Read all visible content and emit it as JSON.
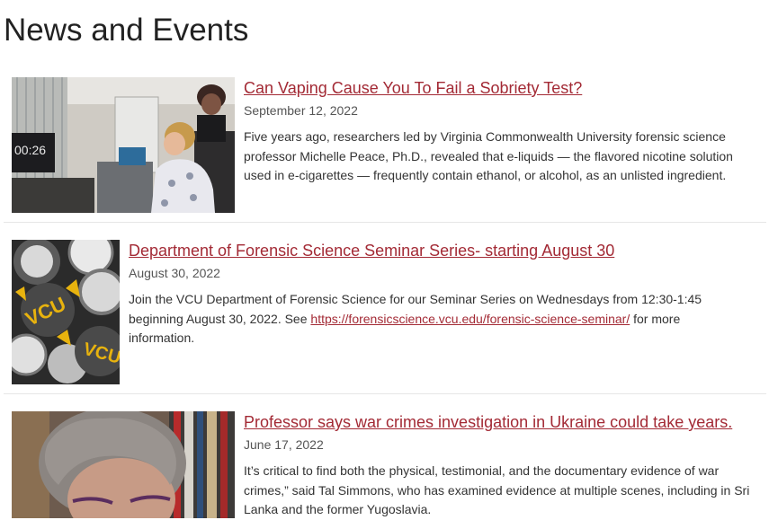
{
  "page": {
    "title": "News and Events"
  },
  "items": [
    {
      "headline": "Can Vaping Cause You To Fail a Sobriety Test?",
      "date": "September 12, 2022",
      "summary": "Five years ago, researchers led by Virginia Commonwealth University forensic science professor Michelle Peace, Ph.D., revealed that e-liquids — the flavored nicotine solution used in e-cigarettes — frequently contain ethanol, or alcohol, as an unlisted ingredient.",
      "thumb_caption": "00:26"
    },
    {
      "headline": "Department of Forensic Science Seminar Series- starting August 30",
      "date": "August 30, 2022",
      "summary_before": "Join the VCU Department of Forensic Science for our Seminar Series on Wednesdays from 12:30-1:45 beginning August 30, 2022. See ",
      "summary_link": "https://forensicscience.vcu.edu/forensic-science-seminar/",
      "summary_after": " for more information.",
      "thumb_caption": "VCU"
    },
    {
      "headline": "Professor says war crimes investigation in Ukraine could take years.",
      "date": "June 17, 2022",
      "summary": "It’s critical to find both the physical, testimonial, and the documentary evidence of war crimes,” said Tal Simmons, who has examined evidence at multiple scenes, including in Sri Lanka and the former Yugoslavia."
    }
  ]
}
